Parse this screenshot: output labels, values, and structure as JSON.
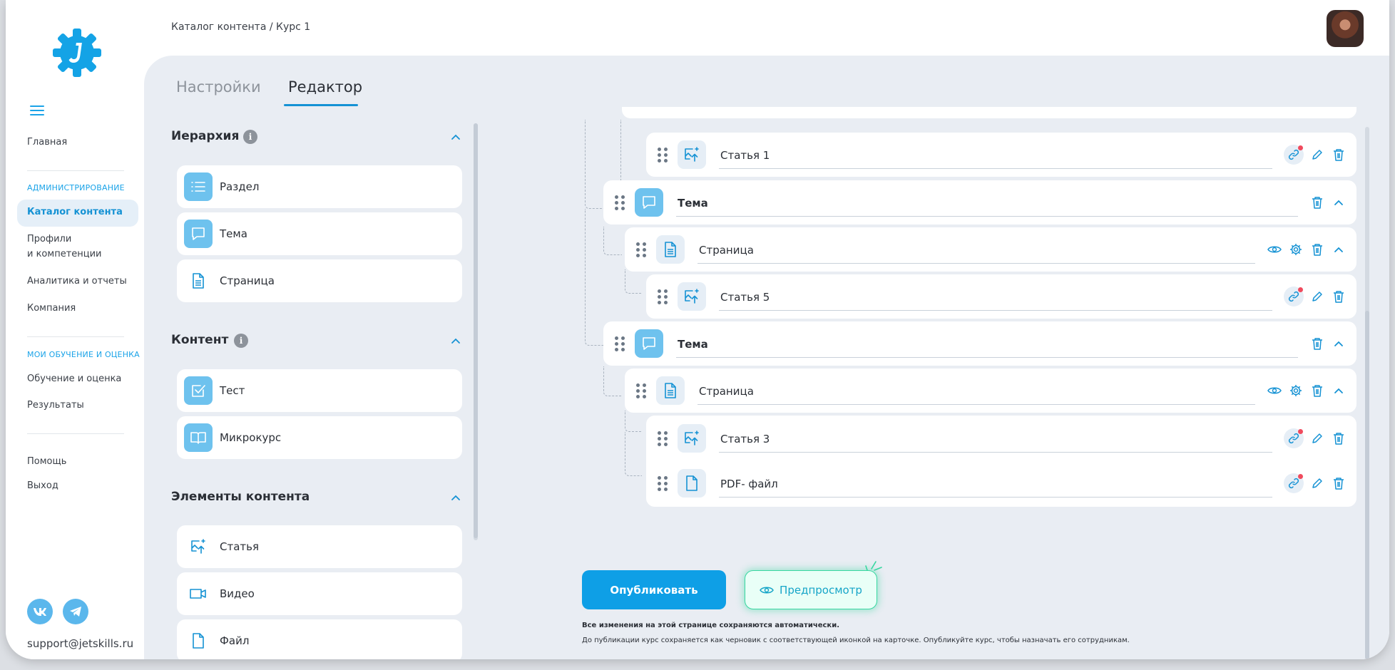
{
  "breadcrumb": "Каталог контента / Курс 1",
  "sidebar": {
    "home": "Главная",
    "admin_section": "АДМИНИСТРИРОВАНИЕ",
    "catalog": "Каталог контента",
    "profiles_line1": "Профили",
    "profiles_line2": "и компетенции",
    "analytics": "Аналитика и отчеты",
    "company": "Компания",
    "my_section": "МОИ ОБУЧЕНИЕ И ОЦЕНКА",
    "learning": "Обучение и оценка",
    "results": "Результаты",
    "help": "Помощь",
    "logout": "Выход",
    "support_email": "support@jetskills.ru"
  },
  "tabs": {
    "settings": "Настройки",
    "editor": "Редактор"
  },
  "palette": {
    "hierarchy": {
      "title": "Иерархия",
      "items": [
        "Раздел",
        "Тема",
        "Страница"
      ]
    },
    "content": {
      "title": "Контент",
      "items": [
        "Тест",
        "Микрокурс"
      ]
    },
    "elements": {
      "title": "Элементы контента",
      "items": [
        "Статья",
        "Видео",
        "Файл"
      ]
    }
  },
  "tree": [
    {
      "level": "article",
      "title": "Статья 1",
      "icon": "image-upload-icon"
    },
    {
      "level": "topic",
      "title": "Тема",
      "icon": "chat-icon"
    },
    {
      "level": "page",
      "title": "Страница",
      "icon": "document-icon"
    },
    {
      "level": "article",
      "title": "Статья 5",
      "icon": "image-upload-icon"
    },
    {
      "level": "topic",
      "title": "Тема",
      "icon": "chat-icon"
    },
    {
      "level": "page",
      "title": "Страница",
      "icon": "document-icon"
    },
    {
      "level": "article",
      "title": "Статья 3",
      "icon": "image-upload-icon"
    },
    {
      "level": "article",
      "title": "PDF- файл",
      "icon": "file-icon"
    }
  ],
  "actions": {
    "publish": "Опубликовать",
    "preview": "Предпросмотр"
  },
  "notes": {
    "autosave": "Все изменения на этой странице сохраняются автоматически.",
    "draft": "До публикации курс сохраняется как черновик с соответствующей иконкой на карточке. Опубликуйте курс, чтобы назначать его сотрудникам."
  },
  "colors": {
    "accent": "#1592d4",
    "primary_button": "#0e9fe6",
    "icon_badge": "#6ec2ee",
    "preview_glow": "#37d7a0",
    "notification_dot": "#f04a5d",
    "panel_bg": "#e9edf3"
  }
}
